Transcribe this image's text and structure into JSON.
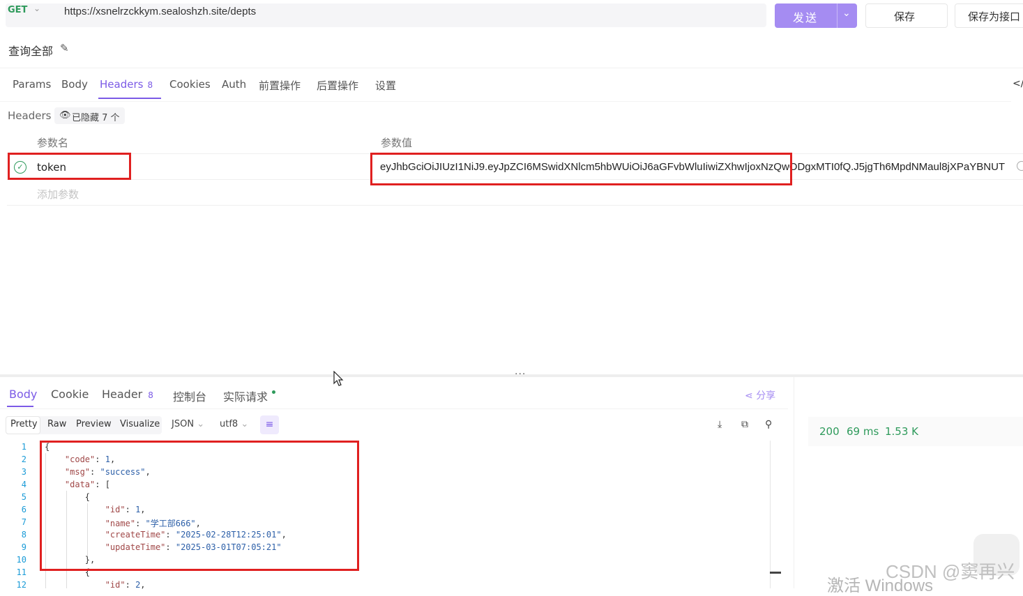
{
  "request": {
    "method": "GET",
    "url": "https://xsnelrzckkym.sealoshzh.site/depts",
    "send_label": "发送",
    "save_label": "保存",
    "save_as_label": "保存为接口",
    "name": "查询全部"
  },
  "request_tabs": [
    {
      "label": "Params"
    },
    {
      "label": "Body"
    },
    {
      "label": "Headers",
      "badge": "8"
    },
    {
      "label": "Cookies"
    },
    {
      "label": "Auth"
    },
    {
      "label": "前置操作"
    },
    {
      "label": "后置操作"
    },
    {
      "label": "设置"
    }
  ],
  "headers_section": {
    "label": "Headers",
    "hidden_chip": "已隐藏 7 个",
    "col_name": "参数名",
    "col_value": "参数值",
    "rows": [
      {
        "name": "token",
        "value": "eyJhbGciOiJIUzI1NiJ9.eyJpZCI6MSwidXNlcm5hbWUiOiJ6aGFvbWluIiwiZXhwIjoxNzQwODgxMTI0fQ.J5jgTh6MpdNMaul8jXPaYBNUT"
      }
    ],
    "add_param": "添加参数"
  },
  "response_tabs": [
    {
      "label": "Body"
    },
    {
      "label": "Cookie"
    },
    {
      "label": "Header",
      "badge": "8"
    },
    {
      "label": "控制台"
    },
    {
      "label": "实际请求"
    }
  ],
  "share_label": "分享",
  "format_tabs": [
    "Pretty",
    "Raw",
    "Preview",
    "Visualize"
  ],
  "format_dropdowns": {
    "type": "JSON",
    "encoding": "utf8"
  },
  "status": {
    "code": "200",
    "time": "69 ms",
    "size": "1.53 K"
  },
  "code_lines": {
    "l1": "{",
    "l2k": "\"code\"",
    "l2v": "1",
    "l3k": "\"msg\"",
    "l3v": "\"success\"",
    "l4k": "\"data\"",
    "l4v": "[",
    "l5": "{",
    "l6k": "\"id\"",
    "l6v": "1",
    "l7k": "\"name\"",
    "l7v": "\"学工部666\"",
    "l8k": "\"createTime\"",
    "l8v": "\"2025-02-28T12:25:01\"",
    "l9k": "\"updateTime\"",
    "l9v": "\"2025-03-01T07:05:21\"",
    "l10": "},",
    "l11": "{",
    "l12k": "\"id\"",
    "l12v": "2"
  },
  "line_numbers": [
    "1",
    "2",
    "3",
    "4",
    "5",
    "6",
    "7",
    "8",
    "9",
    "10",
    "11",
    "12"
  ],
  "watermark": {
    "csdn": "CSDN @窦再兴",
    "windows": "激活 Windows"
  },
  "colors": {
    "accent": "#a58cf2",
    "success": "#2e9a5b",
    "highlight": "#e02020"
  }
}
